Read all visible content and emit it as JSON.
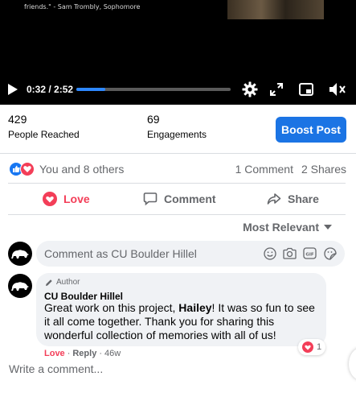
{
  "video": {
    "quote": "friends.\" - Sam Trombly, Sophomore",
    "time": "0:32 / 2:52",
    "progress": 0.19
  },
  "insights": {
    "reached_count": "429",
    "reached_label": "People Reached",
    "engagements_count": "69",
    "engagements_label": "Engagements",
    "boost_label": "Boost Post"
  },
  "reactions": {
    "summary": "You and 8 others",
    "comments": "1 Comment",
    "shares": "2 Shares"
  },
  "actions": {
    "love": "Love",
    "comment": "Comment",
    "share": "Share"
  },
  "sort": {
    "label": "Most Relevant"
  },
  "composer": {
    "placeholder": "Comment as CU Boulder Hillel"
  },
  "comment": {
    "badge": "Author",
    "name": "CU Boulder Hillel",
    "text_before": "Great work on this project, ",
    "text_bold": "Hailey",
    "text_after": "! It was so fun to see it all come together. Thank you for sharing this wonderful collection of memories with all of us!",
    "love": "Love",
    "dot": "·",
    "reply": "Reply",
    "age": "· 46w",
    "reaction_count": "1"
  },
  "write": {
    "placeholder": "Write a comment..."
  },
  "colors": {
    "accent": "#1b74e4",
    "love": "#f33e58",
    "muted": "#65676b"
  }
}
